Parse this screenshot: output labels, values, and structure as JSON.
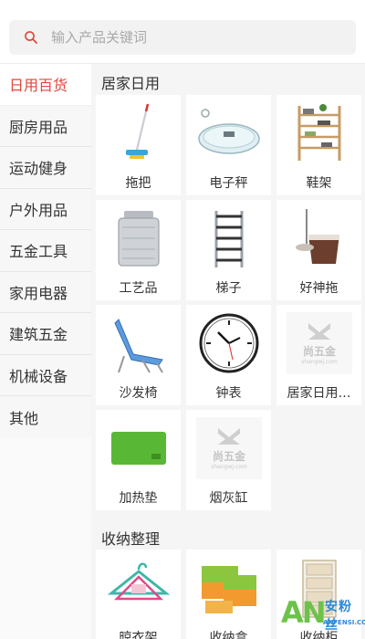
{
  "search": {
    "placeholder": "输入产品关键词",
    "value": ""
  },
  "colors": {
    "accent": "#e0463a",
    "sidebar_bg": "#f7f7f7",
    "content_bg": "#f5f5f5",
    "card_bg": "#ffffff"
  },
  "sidebar": {
    "items": [
      {
        "label": "日用百货",
        "active": true
      },
      {
        "label": "厨房用品",
        "active": false
      },
      {
        "label": "运动健身",
        "active": false
      },
      {
        "label": "户外用品",
        "active": false
      },
      {
        "label": "五金工具",
        "active": false
      },
      {
        "label": "家用电器",
        "active": false
      },
      {
        "label": "建筑五金",
        "active": false
      },
      {
        "label": "机械设备",
        "active": false
      },
      {
        "label": "其他",
        "active": false
      }
    ]
  },
  "sections": [
    {
      "title": "居家日用",
      "products": [
        {
          "name": "拖把",
          "icon": "mop-icon"
        },
        {
          "name": "电子秤",
          "icon": "scale-icon"
        },
        {
          "name": "鞋架",
          "icon": "shoe-rack-icon"
        },
        {
          "name": "工艺品",
          "icon": "canister-icon"
        },
        {
          "name": "梯子",
          "icon": "ladder-icon"
        },
        {
          "name": "好神拖",
          "icon": "spin-mop-icon"
        },
        {
          "name": "沙发椅",
          "icon": "lounge-chair-icon"
        },
        {
          "name": "钟表",
          "icon": "clock-icon"
        },
        {
          "name": "居家日用…",
          "icon": "placeholder-logo-icon",
          "logo_text": "尚五金",
          "logo_sub": "shangwj.com"
        },
        {
          "name": "加热垫",
          "icon": "heating-pad-icon"
        },
        {
          "name": "烟灰缸",
          "icon": "placeholder-logo-icon",
          "logo_text": "尚五金",
          "logo_sub": "shangwj.com"
        }
      ]
    },
    {
      "title": "收纳整理",
      "products": [
        {
          "name": "晾衣架",
          "icon": "hanger-icon"
        },
        {
          "name": "收纳盒",
          "icon": "storage-box-icon"
        },
        {
          "name": "收纳柜",
          "icon": "drawer-cabinet-icon"
        }
      ]
    }
  ],
  "watermark": {
    "logo": "AN",
    "name": "安粉丝",
    "site": "ANFENSI.COM"
  }
}
